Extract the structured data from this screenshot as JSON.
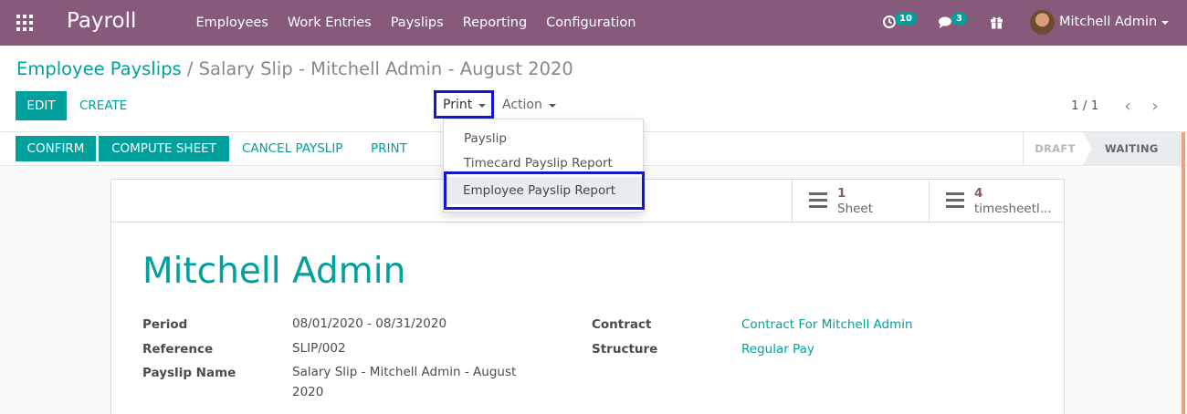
{
  "navbar": {
    "app_name": "Payroll",
    "menu": [
      "Employees",
      "Work Entries",
      "Payslips",
      "Reporting",
      "Configuration"
    ],
    "activity_count": "10",
    "message_count": "3",
    "user": "Mitchell Admin"
  },
  "breadcrumb": {
    "parent": "Employee Payslips",
    "separator": "/",
    "current": "Salary Slip - Mitchell Admin - August 2020"
  },
  "buttons": {
    "edit": "EDIT",
    "create": "CREATE",
    "print": "Print",
    "action": "Action"
  },
  "pager": {
    "value": "1 / 1"
  },
  "print_menu": {
    "items": [
      "Payslip",
      "Timecard Payslip Report",
      "Employee Payslip Report"
    ]
  },
  "statusbar": {
    "confirm": "CONFIRM",
    "compute_sheet": "COMPUTE SHEET",
    "cancel_payslip": "CANCEL PAYSLIP",
    "print": "PRINT",
    "stages": [
      "DRAFT",
      "WAITING"
    ]
  },
  "smart_buttons": [
    {
      "value": "1",
      "label": "Sheet"
    },
    {
      "value": "4",
      "label": "timesheetl..."
    }
  ],
  "form": {
    "employee": "Mitchell Admin",
    "period_label": "Period",
    "period_value": "08/01/2020 - 08/31/2020",
    "reference_label": "Reference",
    "reference_value": "SLIP/002",
    "payslip_name_label": "Payslip Name",
    "payslip_name_value_line1": "Salary Slip - Mitchell Admin - August",
    "payslip_name_value_line2": "2020",
    "contract_label": "Contract",
    "contract_value": "Contract For Mitchell Admin",
    "structure_label": "Structure",
    "structure_value": "Regular Pay"
  },
  "colors": {
    "brand": "#875a7b",
    "primary": "#00a09d",
    "highlight_border": "#1515d0"
  }
}
